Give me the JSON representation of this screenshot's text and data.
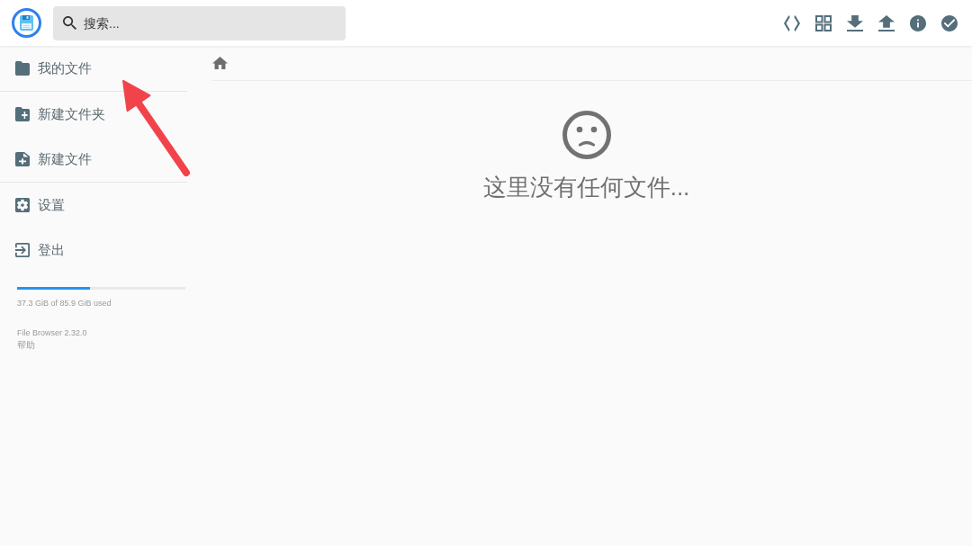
{
  "header": {
    "search": {
      "placeholder": "搜索..."
    }
  },
  "sidebar": {
    "groups": [
      [
        {
          "label": "我的文件"
        }
      ],
      [
        {
          "label": "新建文件夹"
        },
        {
          "label": "新建文件"
        }
      ],
      [
        {
          "label": "设置"
        },
        {
          "label": "登出"
        }
      ]
    ],
    "storage": {
      "level": 0.434,
      "usage": "37.3 GiB of 85.9 GiB used"
    },
    "footer": {
      "version": "File Browser 2.32.0",
      "help_link": "帮助"
    }
  },
  "listing": {
    "empty_message": "这里没有任何文件..."
  }
}
